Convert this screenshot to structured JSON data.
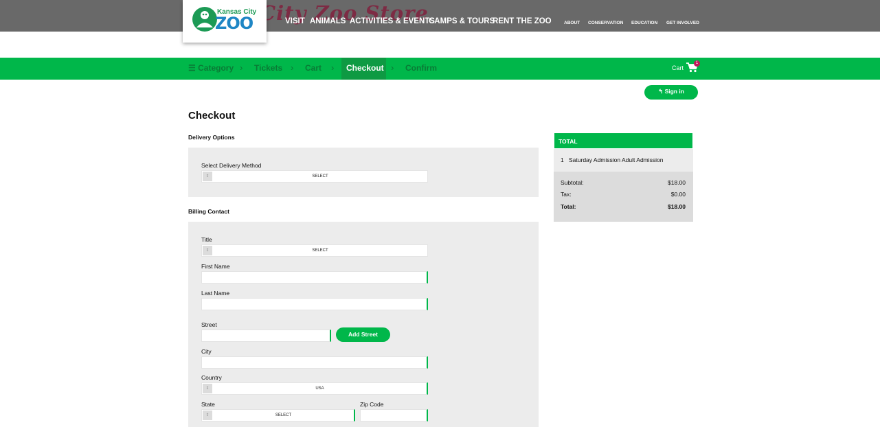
{
  "header": {
    "store_title": "City Zoo Store",
    "logo_small": "Kansas City",
    "logo_big": "ZOO",
    "main_nav": [
      "VISIT",
      "ANIMALS",
      "ACTIVITIES & EVENTS",
      "CAMPS & TOURS",
      "RENT THE ZOO"
    ],
    "sub_nav": [
      "ABOUT",
      "CONSERVATION",
      "EDUCATION",
      "GET INVOLVED"
    ]
  },
  "breadcrumb": {
    "category": "Category",
    "tickets": "Tickets",
    "cart": "Cart",
    "checkout": "Checkout",
    "confirm": "Confirm",
    "chevron": "›",
    "menu_glyph": "☰"
  },
  "cart": {
    "label": "Cart",
    "count": "1"
  },
  "signin": {
    "label": "Sign in",
    "icon": "↰"
  },
  "page": {
    "title": "Checkout"
  },
  "delivery": {
    "heading": "Delivery Options",
    "method_label": "Select Delivery Method",
    "method_value": "SELECT"
  },
  "billing": {
    "heading": "Billing Contact",
    "title_label": "Title",
    "title_value": "SELECT",
    "first_name_label": "First Name",
    "first_name_value": "",
    "last_name_label": "Last Name",
    "last_name_value": "",
    "street_label": "Street",
    "street_value": "",
    "add_street": "Add Street",
    "city_label": "City",
    "city_value": "",
    "country_label": "Country",
    "country_value": "USA",
    "state_label": "State",
    "state_value": "SELECT",
    "zip_label": "Zip Code",
    "zip_value": ""
  },
  "summary": {
    "heading": "TOTAL",
    "item_qty": "1",
    "item_name": "Saturday Admission Adult Admission",
    "subtotal_label": "Subtotal:",
    "subtotal_value": "$18.00",
    "tax_label": "Tax:",
    "tax_value": "$0.00",
    "total_label": "Total:",
    "total_value": "$18.00"
  },
  "colors": {
    "green": "#00b74a",
    "topbar": "#696969",
    "store_title": "#7d2b44",
    "badge": "#c2185b"
  },
  "icons": [
    "zoo-logo-icon",
    "cart-icon",
    "select-arrow-icon",
    "sign-in-icon",
    "menu-icon",
    "chevron-right-icon"
  ]
}
